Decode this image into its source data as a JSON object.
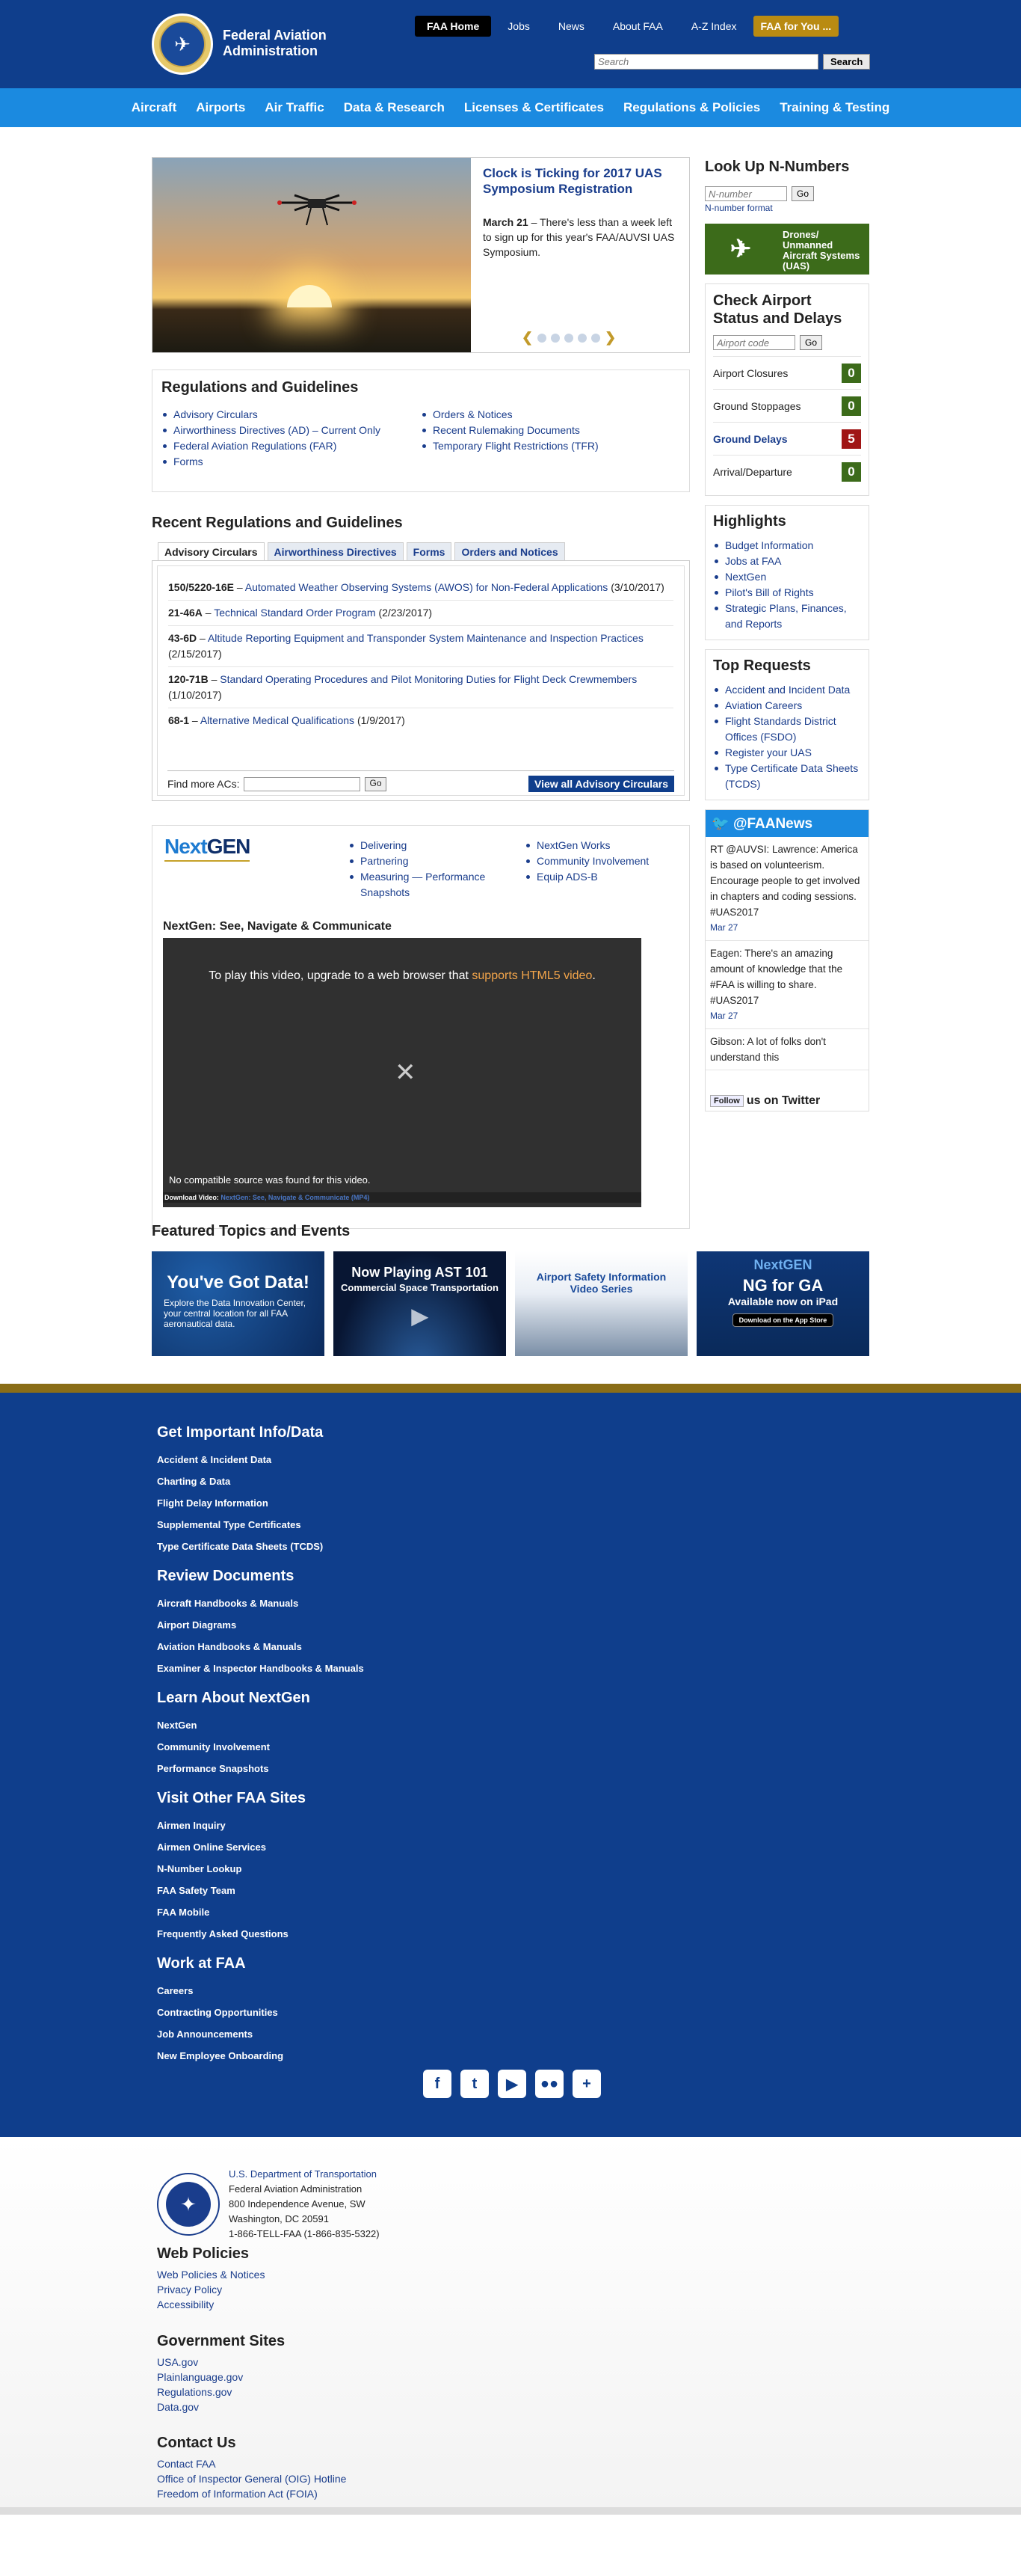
{
  "header": {
    "brand": "Federal Aviation Administration",
    "topnav": [
      "FAA Home",
      "Jobs",
      "News",
      "About FAA",
      "A-Z Index",
      "FAA for You ..."
    ],
    "search_placeholder": "Search",
    "search_button": "Search"
  },
  "mainnav": [
    "Aircraft",
    "Airports",
    "Air Traffic",
    "Data & Research",
    "Licenses & Certificates",
    "Regulations & Policies",
    "Training & Testing"
  ],
  "slider": {
    "title": "Clock is Ticking for 2017 UAS Symposium Registration",
    "date": "March 21",
    "text": " – There's less than a week left to sign up for this year's FAA/AUVSI UAS Symposium."
  },
  "regs": {
    "title": "Regulations and Guidelines",
    "col1": [
      "Advisory Circulars",
      "Airworthiness Directives (AD) – Current Only",
      "Federal Aviation Regulations (FAR)",
      "Forms"
    ],
    "col2": [
      "Orders & Notices",
      "Recent Rulemaking Documents",
      "Temporary Flight Restrictions (TFR)"
    ]
  },
  "recent": {
    "title": "Recent Regulations and Guidelines",
    "tabs": [
      "Advisory Circulars",
      "Airworthiness Directives",
      "Forms",
      "Orders and Notices"
    ],
    "items": [
      {
        "num": "150/5220-16E",
        "link": "Automated Weather Observing Systems (AWOS) for Non-Federal Applications",
        "date": "(3/10/2017)"
      },
      {
        "num": "21-46A",
        "link": "Technical Standard Order Program",
        "date": "(2/23/2017)"
      },
      {
        "num": "43-6D",
        "link": "Altitude Reporting Equipment and Transponder System Maintenance and Inspection Practices",
        "date": "(2/15/2017)"
      },
      {
        "num": "120-71B",
        "link": "Standard Operating Procedures and Pilot Monitoring Duties for Flight Deck Crewmembers",
        "date": "(1/10/2017)"
      },
      {
        "num": "68-1",
        "link": "Alternative Medical Qualifications",
        "date": "(1/9/2017)"
      }
    ],
    "find_label": "Find more ACs:",
    "go": "Go",
    "view_all": "View all Advisory Circulars"
  },
  "nextgen": {
    "logo_a": "Next",
    "logo_b": "GEN",
    "links1": [
      "Delivering",
      "Partnering",
      "Measuring — Performance Snapshots"
    ],
    "links2": [
      "NextGen Works",
      "Community Involvement",
      "Equip ADS-B"
    ],
    "video_title": "NextGen: See, Navigate & Communicate",
    "video_msg_a": "To play this video, upgrade to a web browser that ",
    "video_msg_link": "supports HTML5 video",
    "video_msg_b": ".",
    "no_source": "No compatible source was found for this video.",
    "download_label": "Download Video:",
    "download_link": "NextGen: See, Navigate & Communicate (MP4)"
  },
  "featured": {
    "title": "Featured Topics and Events",
    "items": [
      {
        "h": "You've Got Data!",
        "t": "Explore the Data Innovation Center, your central location for all FAA aeronautical data."
      },
      {
        "h": "Now Playing AST 101",
        "t": "Commercial Space Transportation"
      },
      {
        "h": "Airport Safety Information Video Series",
        "t": ""
      },
      {
        "h": "NG for GA",
        "t": "Available now on iPad",
        "badge": "Download on the App Store",
        "logo": "NextGEN"
      }
    ]
  },
  "right": {
    "nnum_title": "Look Up N-Numbers",
    "nnum_placeholder": "N-number",
    "nnum_format": "N-number format",
    "drone_label": "Drones/ Unmanned Aircraft Systems (UAS)",
    "airport_title": "Check Airport Status and Delays",
    "airport_placeholder": "Airport code",
    "stats": [
      {
        "label": "Airport Closures",
        "count": "0"
      },
      {
        "label": "Ground Stoppages",
        "count": "0"
      },
      {
        "label": "Ground Delays",
        "count": "5"
      },
      {
        "label": "Arrival/Departure",
        "count": "0"
      }
    ],
    "highlights_title": "Highlights",
    "highlights": [
      "Budget Information",
      "Jobs at FAA",
      "NextGen",
      "Pilot's Bill of Rights",
      "Strategic Plans, Finances, and Reports"
    ],
    "top_title": "Top Requests",
    "top": [
      "Accident and Incident Data",
      "Aviation Careers",
      "Flight Standards District Offices (FSDO)",
      "Register your UAS",
      "Type Certificate Data Sheets (TCDS)"
    ],
    "twitter_title": "@FAANews",
    "tweets": [
      "RT @AUVSI: Lawrence: America is based on volunteerism. Encourage people to get involved in chapters and coding sessions. #UAS2017",
      "Eagen: There's an amazing amount of knowledge that the #FAA is willing to share. #UAS2017",
      "Gibson: A lot of folks don't understand this"
    ],
    "tweet_date": "Mar 27",
    "follow": "Follow",
    "on_twitter": "us on Twitter"
  },
  "footer": {
    "sections": [
      {
        "title": "Get Important Info/Data",
        "links": [
          "Accident & Incident Data",
          "Charting & Data",
          "Flight Delay Information",
          "Supplemental Type Certificates",
          "Type Certificate Data Sheets (TCDS)"
        ]
      },
      {
        "title": "Review Documents",
        "links": [
          "Aircraft Handbooks & Manuals",
          "Airport Diagrams",
          "Aviation Handbooks & Manuals",
          "Examiner & Inspector Handbooks & Manuals"
        ]
      },
      {
        "title": "Learn About NextGen",
        "links": [
          "NextGen",
          "Community Involvement",
          "Performance Snapshots"
        ]
      },
      {
        "title": "Visit Other FAA Sites",
        "links": [
          "Airmen Inquiry",
          "Airmen Online Services",
          "N-Number Lookup",
          "FAA Safety Team",
          "FAA Mobile",
          "Frequently Asked Questions"
        ]
      },
      {
        "title": "Work at FAA",
        "links": [
          "Careers",
          "Contracting Opportunities",
          "Job Announcements",
          "New Employee Onboarding"
        ]
      }
    ]
  },
  "dot": {
    "dept": "U.S. Department of Transportation",
    "lines": [
      "Federal Aviation Administration",
      "800 Independence Avenue, SW",
      "Washington, DC 20591",
      "1-866-TELL-FAA (1-866-835-5322)"
    ],
    "policies_title": "Web Policies",
    "policies": [
      "Web Policies & Notices",
      "Privacy Policy",
      "Accessibility"
    ],
    "gov_title": "Government Sites",
    "gov": [
      "USA.gov",
      "Plainlanguage.gov",
      "Regulations.gov",
      "Data.gov"
    ],
    "contact_title": "Contact Us",
    "contact": [
      "Contact FAA",
      "Office of Inspector General (OIG) Hotline",
      "Freedom of Information Act (FOIA)"
    ]
  },
  "colors": {
    "header": "#0f3e8c",
    "nav": "#1b8ae0",
    "gold": "#b98b12",
    "green": "#3c6b1a",
    "red": "#a01515"
  }
}
